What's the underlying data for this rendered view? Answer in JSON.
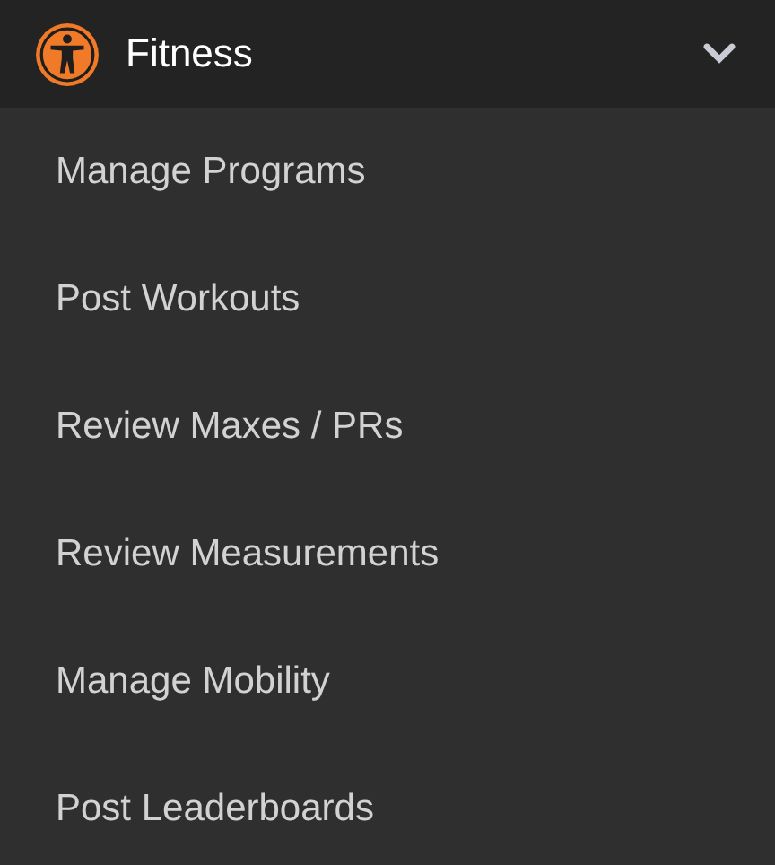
{
  "menu": {
    "title": "Fitness",
    "expanded": true,
    "items": [
      {
        "label": "Manage Programs"
      },
      {
        "label": "Post Workouts"
      },
      {
        "label": "Review Maxes / PRs"
      },
      {
        "label": "Review Measurements"
      },
      {
        "label": "Manage Mobility"
      },
      {
        "label": "Post Leaderboards"
      }
    ]
  }
}
